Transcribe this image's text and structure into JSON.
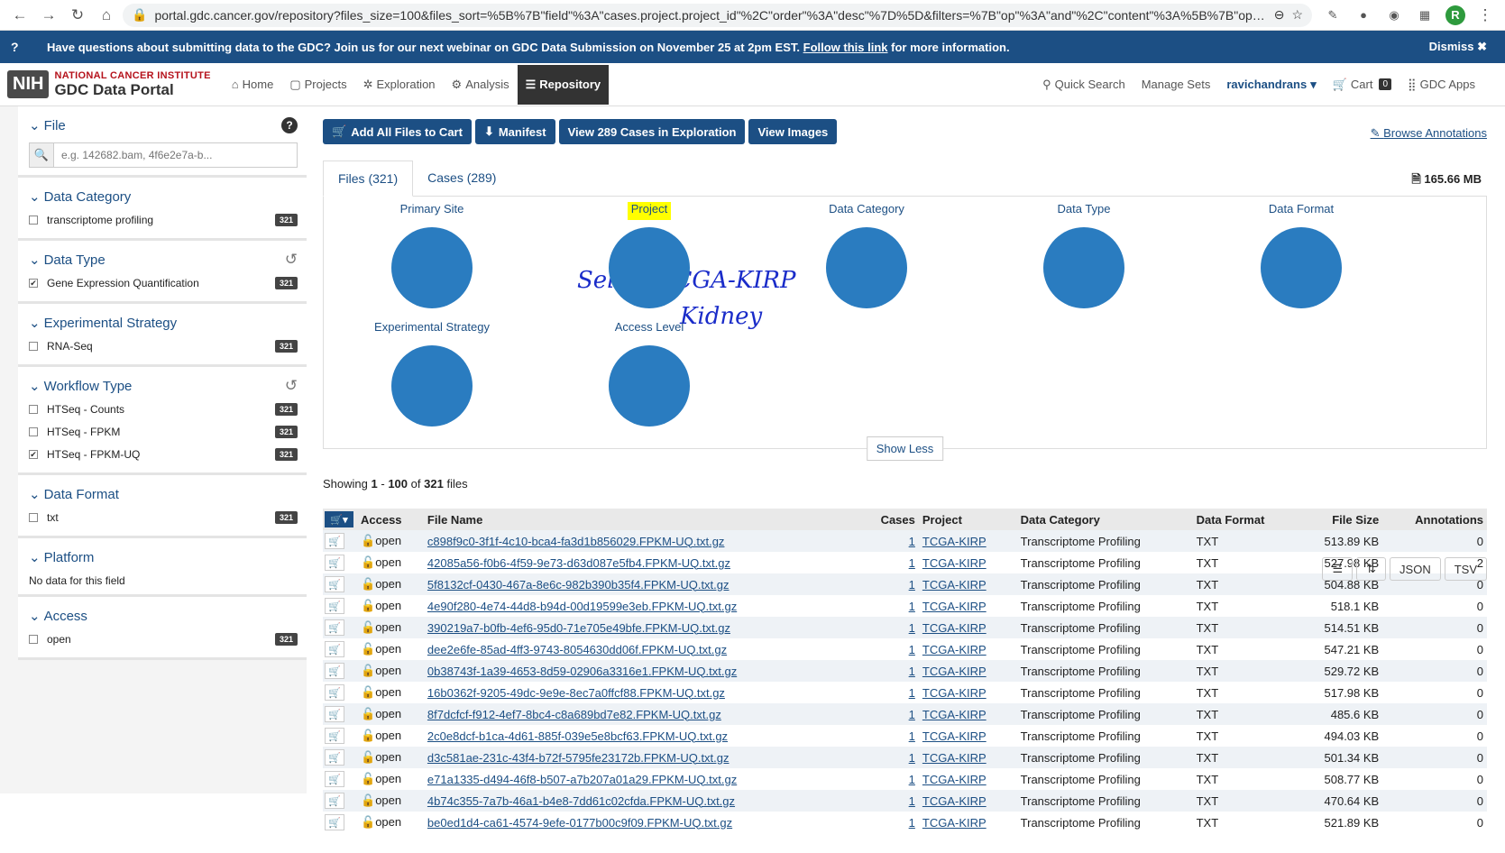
{
  "browser": {
    "url": "portal.gdc.cancer.gov/repository?files_size=100&files_sort=%5B%7B\"field\"%3A\"cases.project.project_id\"%2C\"order\"%3A\"desc\"%7D%5D&filters=%7B\"op\"%3A\"and\"%2C\"content\"%3A%5B%7B\"op\"%3A...",
    "profile_initial": "R"
  },
  "banner": {
    "question": "?",
    "message": "Have questions about submitting data to the GDC? Join us for our next webinar on GDC Data Submission on November 25 at 2pm EST.",
    "link": "Follow this link",
    "tail": "for more information.",
    "dismiss": "Dismiss ✖"
  },
  "logo": {
    "nih": "NIH",
    "line1": "NATIONAL CANCER INSTITUTE",
    "line2": "GDC Data Portal"
  },
  "nav": {
    "home": "Home",
    "projects": "Projects",
    "exploration": "Exploration",
    "analysis": "Analysis",
    "repository": "Repository",
    "quick_search": "Quick Search",
    "manage_sets": "Manage Sets",
    "user": "ravichandrans",
    "cart": "Cart",
    "cart_count": "0",
    "apps": "GDC Apps"
  },
  "sidebar": {
    "file": {
      "title": "File",
      "placeholder": "e.g. 142682.bam, 4f6e2e7a-b..."
    },
    "data_category": {
      "title": "Data Category",
      "items": [
        {
          "label": "transcriptome profiling",
          "count": "321",
          "checked": ""
        }
      ]
    },
    "data_type": {
      "title": "Data Type",
      "items": [
        {
          "label": "Gene Expression Quantification",
          "count": "321",
          "checked": "✔"
        }
      ]
    },
    "experimental_strategy": {
      "title": "Experimental Strategy",
      "items": [
        {
          "label": "RNA-Seq",
          "count": "321",
          "checked": ""
        }
      ]
    },
    "workflow_type": {
      "title": "Workflow Type",
      "items": [
        {
          "label": "HTSeq - Counts",
          "count": "321",
          "checked": ""
        },
        {
          "label": "HTSeq - FPKM",
          "count": "321",
          "checked": ""
        },
        {
          "label": "HTSeq - FPKM-UQ",
          "count": "321",
          "checked": "✔"
        }
      ]
    },
    "data_format": {
      "title": "Data Format",
      "items": [
        {
          "label": "txt",
          "count": "321",
          "checked": ""
        }
      ]
    },
    "platform": {
      "title": "Platform",
      "empty": "No data for this field"
    },
    "access": {
      "title": "Access",
      "items": [
        {
          "label": "open",
          "count": "321",
          "checked": ""
        }
      ]
    }
  },
  "actions": {
    "add_all": "Add All Files to Cart",
    "manifest": "Manifest",
    "view_cases": "View 289 Cases in Exploration",
    "view_images": "View Images",
    "browse_annotations": "Browse Annotations"
  },
  "tabs": {
    "files": "Files (321)",
    "cases": "Cases (289)",
    "total_size": "165.66 MB"
  },
  "annotation": {
    "line1": "Select TCGA-KIRP",
    "line2": "Kidney"
  },
  "charts": {
    "primary_site": "Primary Site",
    "project": "Project",
    "data_category": "Data Category",
    "data_type": "Data Type",
    "data_format": "Data Format",
    "experimental_strategy": "Experimental Strategy",
    "access_level": "Access Level",
    "show_less": "Show Less"
  },
  "summary": {
    "prefix": "Showing",
    "range_start": "1",
    "range_sep": "-",
    "range_end": "100",
    "of": "of",
    "total": "321",
    "unit": "files"
  },
  "tools": {
    "json": "JSON",
    "tsv": "TSV"
  },
  "table": {
    "headers": {
      "access": "Access",
      "file_name": "File Name",
      "cases": "Cases",
      "project": "Project",
      "data_category": "Data Category",
      "data_format": "Data Format",
      "file_size": "File Size",
      "annotations": "Annotations"
    },
    "rows": [
      {
        "access": "open",
        "file": "c898f9c0-3f1f-4c10-bca4-fa3d1b856029.FPKM-UQ.txt.gz",
        "cases": "1",
        "project": "TCGA-KIRP",
        "category": "Transcriptome Profiling",
        "format": "TXT",
        "size": "513.89 KB",
        "ann": "0"
      },
      {
        "access": "open",
        "file": "42085a56-f0b6-4f59-9e73-d63d087e5fb4.FPKM-UQ.txt.gz",
        "cases": "1",
        "project": "TCGA-KIRP",
        "category": "Transcriptome Profiling",
        "format": "TXT",
        "size": "527.98 KB",
        "ann": "2"
      },
      {
        "access": "open",
        "file": "5f8132cf-0430-467a-8e6c-982b390b35f4.FPKM-UQ.txt.gz",
        "cases": "1",
        "project": "TCGA-KIRP",
        "category": "Transcriptome Profiling",
        "format": "TXT",
        "size": "504.88 KB",
        "ann": "0"
      },
      {
        "access": "open",
        "file": "4e90f280-4e74-44d8-b94d-00d19599e3eb.FPKM-UQ.txt.gz",
        "cases": "1",
        "project": "TCGA-KIRP",
        "category": "Transcriptome Profiling",
        "format": "TXT",
        "size": "518.1 KB",
        "ann": "0"
      },
      {
        "access": "open",
        "file": "390219a7-b0fb-4ef6-95d0-71e705e49bfe.FPKM-UQ.txt.gz",
        "cases": "1",
        "project": "TCGA-KIRP",
        "category": "Transcriptome Profiling",
        "format": "TXT",
        "size": "514.51 KB",
        "ann": "0"
      },
      {
        "access": "open",
        "file": "dee2e6fe-85ad-4ff3-9743-8054630dd06f.FPKM-UQ.txt.gz",
        "cases": "1",
        "project": "TCGA-KIRP",
        "category": "Transcriptome Profiling",
        "format": "TXT",
        "size": "547.21 KB",
        "ann": "0"
      },
      {
        "access": "open",
        "file": "0b38743f-1a39-4653-8d59-02906a3316e1.FPKM-UQ.txt.gz",
        "cases": "1",
        "project": "TCGA-KIRP",
        "category": "Transcriptome Profiling",
        "format": "TXT",
        "size": "529.72 KB",
        "ann": "0"
      },
      {
        "access": "open",
        "file": "16b0362f-9205-49dc-9e9e-8ec7a0ffcf88.FPKM-UQ.txt.gz",
        "cases": "1",
        "project": "TCGA-KIRP",
        "category": "Transcriptome Profiling",
        "format": "TXT",
        "size": "517.98 KB",
        "ann": "0"
      },
      {
        "access": "open",
        "file": "8f7dcfcf-f912-4ef7-8bc4-c8a689bd7e82.FPKM-UQ.txt.gz",
        "cases": "1",
        "project": "TCGA-KIRP",
        "category": "Transcriptome Profiling",
        "format": "TXT",
        "size": "485.6 KB",
        "ann": "0"
      },
      {
        "access": "open",
        "file": "2c0e8dcf-b1ca-4d61-885f-039e5e8bcf63.FPKM-UQ.txt.gz",
        "cases": "1",
        "project": "TCGA-KIRP",
        "category": "Transcriptome Profiling",
        "format": "TXT",
        "size": "494.03 KB",
        "ann": "0"
      },
      {
        "access": "open",
        "file": "d3c581ae-231c-43f4-b72f-5795fe23172b.FPKM-UQ.txt.gz",
        "cases": "1",
        "project": "TCGA-KIRP",
        "category": "Transcriptome Profiling",
        "format": "TXT",
        "size": "501.34 KB",
        "ann": "0"
      },
      {
        "access": "open",
        "file": "e71a1335-d494-46f8-b507-a7b207a01a29.FPKM-UQ.txt.gz",
        "cases": "1",
        "project": "TCGA-KIRP",
        "category": "Transcriptome Profiling",
        "format": "TXT",
        "size": "508.77 KB",
        "ann": "0"
      },
      {
        "access": "open",
        "file": "4b74c355-7a7b-46a1-b4e8-7dd61c02cfda.FPKM-UQ.txt.gz",
        "cases": "1",
        "project": "TCGA-KIRP",
        "category": "Transcriptome Profiling",
        "format": "TXT",
        "size": "470.64 KB",
        "ann": "0"
      },
      {
        "access": "open",
        "file": "be0ed1d4-ca61-4574-9efe-0177b00c9f09.FPKM-UQ.txt.gz",
        "cases": "1",
        "project": "TCGA-KIRP",
        "category": "Transcriptome Profiling",
        "format": "TXT",
        "size": "521.89 KB",
        "ann": "0"
      }
    ]
  }
}
